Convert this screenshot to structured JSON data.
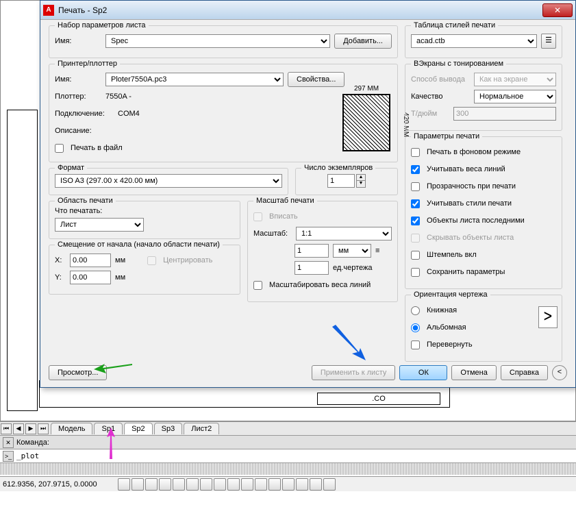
{
  "window": {
    "title": "Печать - Sp2"
  },
  "page_setup": {
    "group": "Набор параметров листа",
    "name_label": "Имя:",
    "name_value": "Spec",
    "add_btn": "Добавить..."
  },
  "printer": {
    "group": "Принтер/плоттер",
    "name_label": "Имя:",
    "name_value": "Ploter7550A.pc3",
    "props_btn": "Свойства...",
    "plotter_label": "Плоттер:",
    "plotter_value": "7550A -",
    "conn_label": "Подключение:",
    "conn_value": "COM4",
    "desc_label": "Описание:",
    "to_file": "Печать в файл",
    "paper_w": "297  MM",
    "paper_h": "420 MM"
  },
  "format": {
    "group": "Формат",
    "value": "ISO A3 (297.00 x 420.00 мм)"
  },
  "copies": {
    "group": "Число экземпляров",
    "value": "1"
  },
  "area": {
    "group": "Область печати",
    "what_label": "Что печатать:",
    "what_value": "Лист"
  },
  "offset": {
    "group": "Смещение от начала (начало области печати)",
    "x_label": "X:",
    "x_value": "0.00",
    "y_label": "Y:",
    "y_value": "0.00",
    "unit": "мм",
    "center": "Центрировать"
  },
  "scale": {
    "group": "Масштаб печати",
    "fit": "Вписать",
    "scale_label": "Масштаб:",
    "scale_value": "1:1",
    "val1": "1",
    "unit": "мм",
    "val2": "1",
    "unit2": "ед.чертежа",
    "scale_weights": "Масштабировать веса линий"
  },
  "styles": {
    "group": "Таблица стилей печати",
    "value": "acad.ctb"
  },
  "shaded": {
    "group": "ВЭкраны с тонированием",
    "method_label": "Способ вывода",
    "method_value": "Как на экране",
    "quality_label": "Качество",
    "quality_value": "Нормальное",
    "dpi_label": "Т/дюйм",
    "dpi_value": "300"
  },
  "options": {
    "group": "Параметры печати",
    "bg": "Печать в фоновом режиме",
    "weights": "Учитывать веса линий",
    "trans": "Прозрачность при печати",
    "styles": "Учитывать стили печати",
    "paperspace": "Объекты листа последними",
    "hide": "Скрывать объекты листа",
    "stamp": "Штемпель вкл",
    "save": "Сохранить параметры"
  },
  "orient": {
    "group": "Ориентация чертежа",
    "portrait": "Книжная",
    "landscape": "Альбомная",
    "upside": "Перевернуть"
  },
  "buttons": {
    "preview": "Просмотр...",
    "apply": "Применить к листу",
    "ok": "ОК",
    "cancel": "Отмена",
    "help": "Справка"
  },
  "tabs": [
    "Модель",
    "Sp1",
    "Sp2",
    "Sp3",
    "Лист2"
  ],
  "cmd": {
    "label": "Команда:",
    "input": "_plot"
  },
  "status": {
    "coords": "612.9356, 207.9715, 0.0000"
  },
  "canvas": {
    "co": ".CO"
  }
}
